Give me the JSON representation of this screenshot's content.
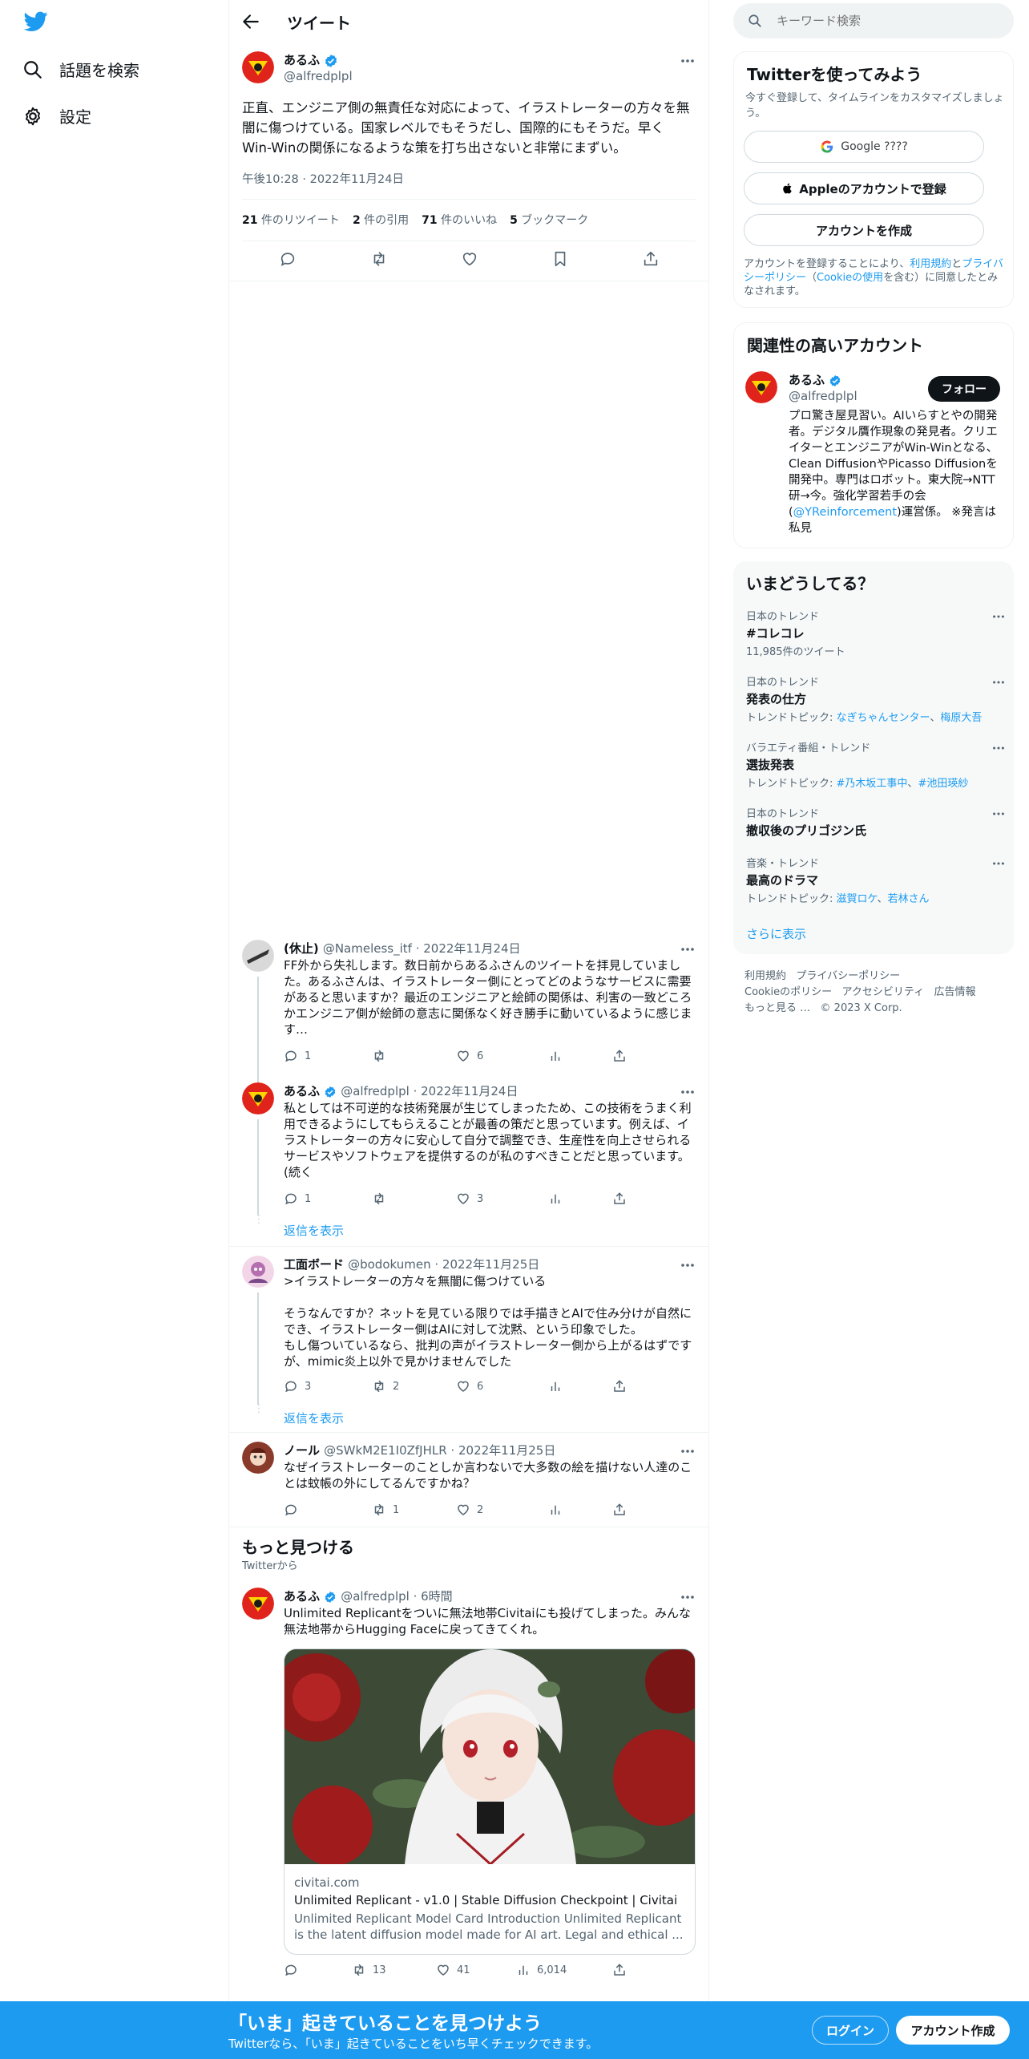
{
  "sidebar": {
    "items": [
      {
        "label": "話題を検索",
        "icon": "search-icon"
      },
      {
        "label": "設定",
        "icon": "gear-icon"
      }
    ]
  },
  "header": {
    "title": "ツイート"
  },
  "tweet": {
    "name": "あるふ",
    "handle": "@alfredplpl",
    "text": "正直、エンジニア側の無責任な対応によって、イラストレーターの方々を無闇に傷つけている。国家レベルでもそうだし、国際的にもそうだ。早くWin-Winの関係になるような策を打ち出さないと非常にまずい。",
    "time": "午後10:28",
    "date": "2022年11月24日",
    "stats": {
      "retweets_num": "21",
      "retweets_label": "件のリツイート",
      "quotes_num": "2",
      "quotes_label": "件の引用",
      "likes_num": "71",
      "likes_label": "件のいいね",
      "bookmarks_num": "5",
      "bookmarks_label": "ブックマーク"
    }
  },
  "replies": [
    {
      "name": "(休止)",
      "handle": "@Nameless_itf",
      "date": "2022年11月24日",
      "text": "FF外から失礼します。数日前からあるふさんのツイートを拝見していました。あるふさんは、イラストレーター側にとってどのようなサービスに需要があると思いますか？最近のエンジニアと絵師の関係は、利害の一致どころかエンジニア側が絵師の意志に関係なく好き勝手に動いているように感じます…",
      "reply_count": "1",
      "retweet_count": "",
      "like_count": "6"
    },
    {
      "name": "あるふ",
      "handle": "@alfredplpl",
      "date": "2022年11月24日",
      "text": "私としては不可逆的な技術発展が生じてしまったため、この技術をうまく利用できるようにしてもらえることが最善の策だと思っています。例えば、イラストレーターの方々に安心して自分で調整でき、生産性を向上させられるサービスやソフトウェアを提供するのが私のすべきことだと思っています。(続く",
      "reply_count": "1",
      "retweet_count": "",
      "like_count": "3",
      "show_replies": "返信を表示"
    },
    {
      "name": "工面ボード",
      "handle": "@bodokumen",
      "date": "2022年11月25日",
      "text": ">イラストレーターの方々を無闇に傷つけている\n\nそうなんですか？ネットを見ている限りでは手描きとAIで住み分けが自然にでき、イラストレーター側はAIに対して沈黙、という印象でした。\nもし傷ついているなら、批判の声がイラストレーター側から上がるはずですが、mimic炎上以外で見かけませんでした",
      "reply_count": "3",
      "retweet_count": "2",
      "like_count": "6",
      "show_replies": "返信を表示"
    },
    {
      "name": "ノール",
      "handle": "@SWkM2E1I0ZfJHLR",
      "date": "2022年11月25日",
      "text": "なぜイラストレーターのことしか言わないで大多数の絵を描けない人達のことは蚊帳の外にしてるんですかね？",
      "reply_count": "",
      "retweet_count": "1",
      "like_count": "2"
    }
  ],
  "more": {
    "title": "もっと見つける",
    "subtitle": "Twitterから",
    "tweet": {
      "name": "あるふ",
      "handle": "@alfredplpl",
      "time": "6時間",
      "text": "Unlimited Replicantをついに無法地帯Civitaiにも投げてしまった。みんな無法地帯からHugging Faceに戻ってきてくれ。",
      "card_domain": "civitai.com",
      "card_title": "Unlimited Replicant - v1.0 | Stable Diffusion Checkpoint | Civitai",
      "card_desc": "Unlimited Replicant Model Card Introduction Unlimited Replicant is the latent diffusion model made for AI art. Legal and ethical ...",
      "reply_count": "",
      "retweet_count": "13",
      "like_count": "41",
      "view_count": "6,014"
    }
  },
  "search": {
    "placeholder": "キーワード検索"
  },
  "signup": {
    "title": "Twitterを使ってみよう",
    "subtitle": "今すぐ登録して、タイムラインをカスタマイズしましょう。",
    "google_label": "Google ????",
    "apple_label": "Appleのアカウントで登録",
    "create_label": "アカウントを作成",
    "terms_prefix": "アカウントを登録することにより、",
    "terms_link": "利用規約",
    "terms_and": "と",
    "privacy_link": "プライバシーポリシー",
    "cookie_open": "（",
    "cookie_link": "Cookieの使用",
    "cookie_close": "を含む）に同意したとみなされます。"
  },
  "relevant": {
    "title": "関連性の高いアカウント",
    "name": "あるふ",
    "handle": "@alfredplpl",
    "follow_label": "フォロー",
    "bio_before": "プロ驚き屋見習い。AIいらすとやの開発者。デジタル贋作現象の発見者。クリエイターとエンジニアがWin-Winとなる、Clean DiffusionやPicasso Diffusionを開発中。専門はロボット。東大院→NTT研→今。強化学習若手の会 (",
    "bio_link": "@YReinforcement",
    "bio_after": ")運営係。 ※発言は私見"
  },
  "trends": {
    "title": "いまどうしてる？",
    "items": [
      {
        "category": "日本のトレンド",
        "name": "#コレコレ",
        "sub": "11,985件のツイート",
        "topics": []
      },
      {
        "category": "日本のトレンド",
        "name": "発表の仕方",
        "sub": "トレンドトピック: ",
        "topics": [
          "なぎちゃんセンター",
          "梅原大吾"
        ]
      },
      {
        "category": "バラエティ番組・トレンド",
        "name": "選抜発表",
        "sub": "トレンドトピック: ",
        "topics": [
          "#乃木坂工事中",
          "#池田瑛紗"
        ]
      },
      {
        "category": "日本のトレンド",
        "name": "撤収後のプリゴジン氏",
        "sub": "",
        "topics": []
      },
      {
        "category": "音楽・トレンド",
        "name": "最高のドラマ",
        "sub": "トレンドトピック: ",
        "topics": [
          "滋賀ロケ",
          "若林さん"
        ]
      }
    ],
    "show_more": "さらに表示"
  },
  "footer": {
    "links": [
      "利用規約",
      "プライバシーポリシー",
      "Cookieのポリシー",
      "アクセシビリティ",
      "広告情報",
      "もっと見る …"
    ],
    "copyright": "© 2023 X Corp."
  },
  "bottombar": {
    "title": "「いま」起きていることを見つけよう",
    "subtitle": "Twitterなら、「いま」起きていることをいち早くチェックできます。",
    "login_label": "ログイン",
    "signup_label": "アカウント作成"
  },
  "colors": {
    "accent": "#1d9bf0",
    "text": "#0f1419",
    "muted": "#536471",
    "border": "#eff3f4"
  }
}
